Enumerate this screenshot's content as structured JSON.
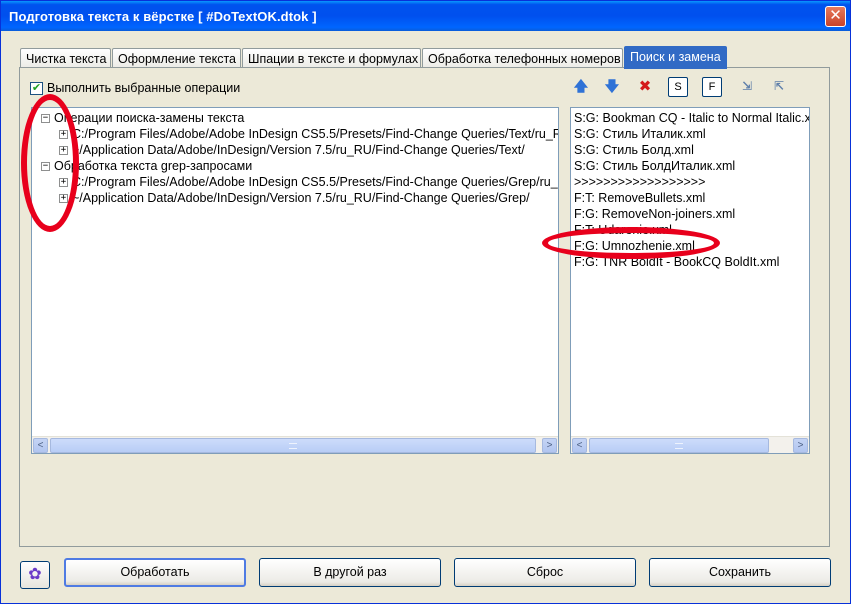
{
  "window": {
    "title": "Подготовка текста к вёрстке  [ #DoTextOK.dtok ]",
    "close_glyph": "✕"
  },
  "tabs": [
    {
      "label": "Чистка текста",
      "active": false
    },
    {
      "label": "Оформление текста",
      "active": false
    },
    {
      "label": "Шпации в тексте и формулах",
      "active": false
    },
    {
      "label": "Обработка телефонных номеров",
      "active": false
    },
    {
      "label": "Поиск и замена",
      "active": true
    }
  ],
  "options": {
    "execute_selected_checked": true,
    "execute_selected_label": "Выполнить выбранные операции",
    "check_glyph": "✔"
  },
  "toolbar": {
    "up_glyph": "🡅",
    "down_glyph": "🡇",
    "delete_glyph": "✖",
    "s_label": "S",
    "f_label": "F",
    "import_glyph": "⇲",
    "export_glyph": "⇱"
  },
  "tree": {
    "collapse_glyph": "−",
    "expand_glyph": "+",
    "groups": [
      {
        "label": "Операции поиска-замены текста",
        "children": [
          "C:/Program Files/Adobe/Adobe InDesign CS5.5/Presets/Find-Change Queries/Text/ru_RU",
          "~/Application Data/Adobe/InDesign/Version 7.5/ru_RU/Find-Change Queries/Text/"
        ]
      },
      {
        "label": "Обработка текста grep-запросами",
        "children": [
          "C:/Program Files/Adobe/Adobe InDesign CS5.5/Presets/Find-Change Queries/Grep/ru_RU",
          "~/Application Data/Adobe/InDesign/Version 7.5/ru_RU/Find-Change Queries/Grep/"
        ]
      }
    ]
  },
  "queue": [
    "S:G: Bookman CQ - Italic to Normal Italic.xml",
    "S:G: Стиль Италик.xml",
    "S:G: Стиль Болд.xml",
    "S:G: Стиль БолдИталик.xml",
    ">>>>>>>>>>>>>>>>>>",
    "F:T: RemoveBullets.xml",
    "F:G: RemoveNon-joiners.xml",
    "F:T: Udarenie.xml",
    "F:G: Umnozhenie.xml",
    "F:G: TNR BoldIt - BookCQ BoldIt.xml"
  ],
  "scroll": {
    "left_glyph": "<",
    "right_glyph": ">"
  },
  "buttons": {
    "logo_glyph": "✿",
    "process": "Обработать",
    "later": "В другой раз",
    "reset": "Сброс",
    "save": "Сохранить"
  },
  "annotation_color": "#e8001c",
  "accent_color": "#316ac5"
}
